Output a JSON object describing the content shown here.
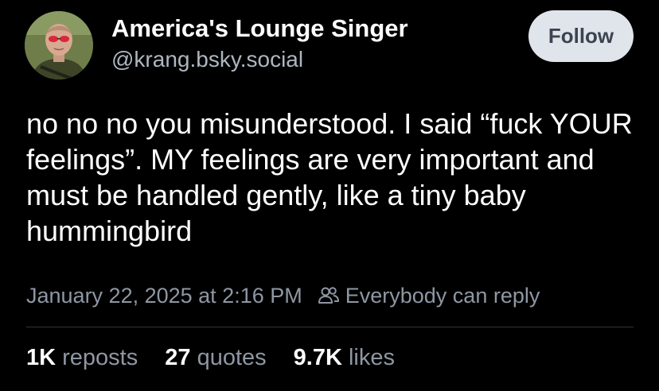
{
  "author": {
    "display_name": "America's Lounge Singer",
    "handle": "@krang.bsky.social",
    "avatar_icon": "avatar-photo"
  },
  "follow_button": {
    "label": "Follow"
  },
  "post": {
    "text": "no no no you misunderstood. I said “fuck YOUR feelings”. MY feelings are very important and must be handled gently, like a tiny baby hummingbird",
    "timestamp": "January 22, 2025 at 2:16 PM",
    "reply_setting": "Everybody can reply",
    "reply_setting_icon": "people-icon"
  },
  "stats": {
    "reposts": {
      "count": "1K",
      "label": "reposts"
    },
    "quotes": {
      "count": "27",
      "label": "quotes"
    },
    "likes": {
      "count": "9.7K",
      "label": "likes"
    }
  },
  "colors": {
    "background": "#000000",
    "text_primary": "#ffffff",
    "text_secondary": "#8e97a3",
    "follow_button_bg": "#e0e5eb",
    "follow_button_text": "#3c4450",
    "divider": "#2e343c"
  }
}
